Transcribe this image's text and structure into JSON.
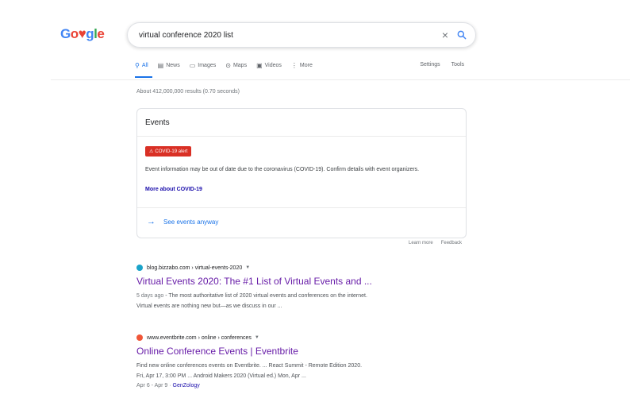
{
  "logo": {
    "text": "Google"
  },
  "search": {
    "query": "virtual conference 2020 list",
    "clear_icon": "×"
  },
  "tabs": {
    "all": "All",
    "news": "News",
    "images": "Images",
    "maps": "Maps",
    "videos": "Videos",
    "more": "More",
    "settings": "Settings",
    "tools": "Tools"
  },
  "stats": "About 412,000,000 results (0.70 seconds)",
  "events_card": {
    "title": "Events",
    "alert": "COVID-19 alert",
    "message": "Event information may be out of date due to the coronavirus (COVID-19). Confirm details with event organizers.",
    "more_link": "More about COVID-19",
    "see_events": "See events anyway",
    "learn_more": "Learn more",
    "feedback": "Feedback"
  },
  "results": [
    {
      "cite": "blog.bizzabo.com › virtual-events-2020",
      "title": "Virtual Events 2020: The #1 List of Virtual Events and ...",
      "date": "5 days ago",
      "snippet_line1": " - The most authoritative list of 2020 virtual events and conferences on the internet.",
      "snippet_line2": "Virtual events are nothing new but—as we discuss in our ...",
      "favicon_color": "#1aa3c9"
    },
    {
      "cite": "www.eventbrite.com › online › conferences",
      "title": "Online Conference Events | Eventbrite",
      "snippet_line1": "Find new online conferences events on Eventbrite. ... React Summit - Remote Edition 2020.",
      "snippet_line2": "Fri, Apr 17, 3:00 PM ... Android Makers 2020 (Virtual ed.) Mon, Apr ...",
      "sitelink_date": "Apr 6 - Apr 9",
      "sitelink": "GenZology",
      "favicon_color": "#f05537"
    }
  ],
  "colors": {
    "accent": "#1a73e8",
    "visited": "#681da8",
    "alert": "#d93025"
  }
}
